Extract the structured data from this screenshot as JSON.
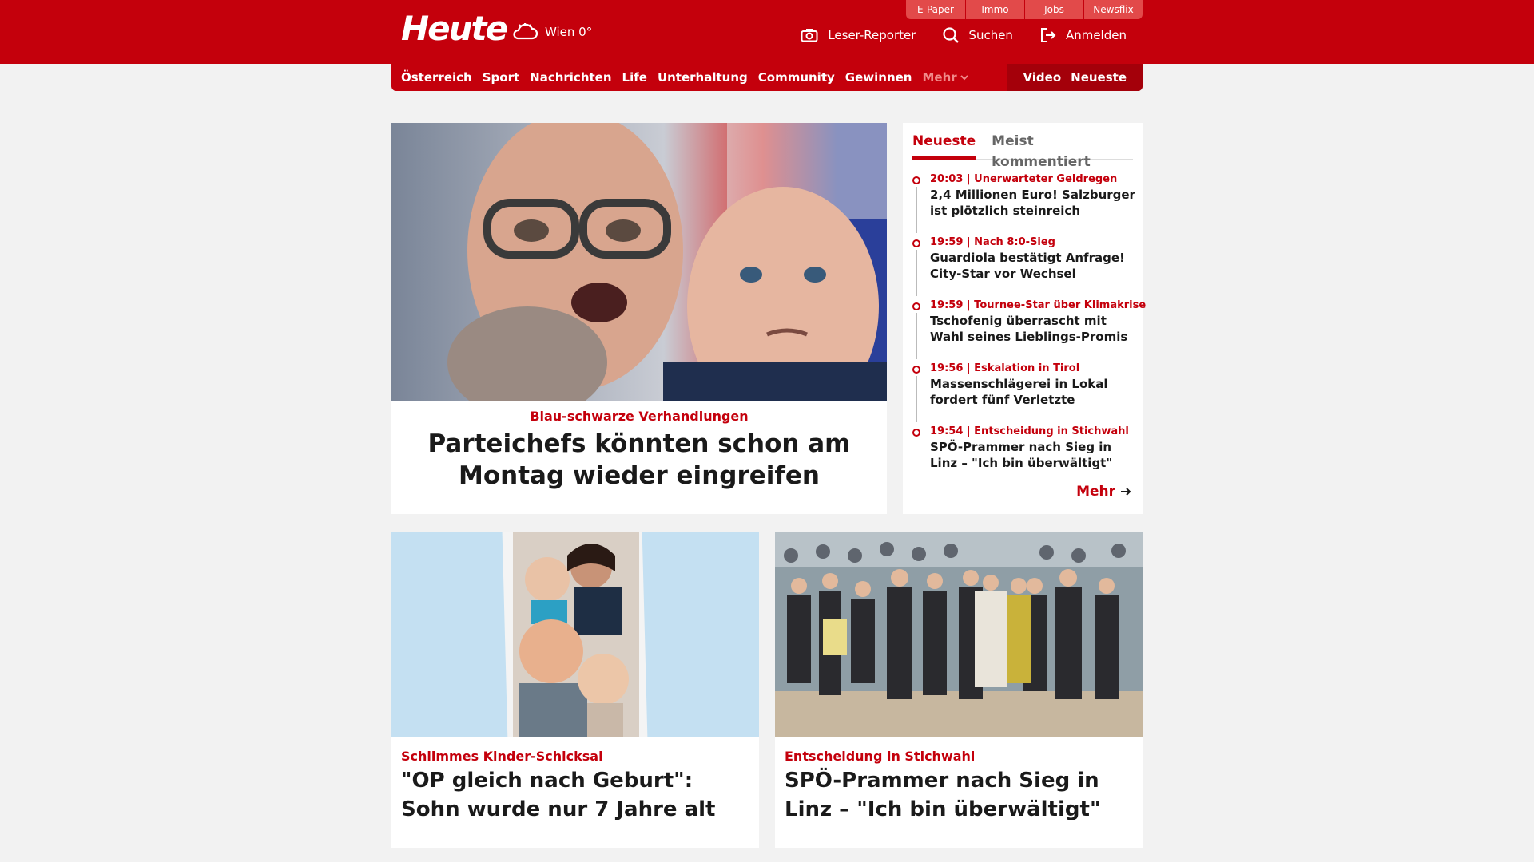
{
  "header": {
    "logo": "Heute",
    "weather": "Wien 0°",
    "quicklinks": [
      "E-Paper",
      "Immo",
      "Jobs",
      "Newsflix"
    ],
    "tools": {
      "reporter": "Leser-Reporter",
      "search": "Suchen",
      "login": "Anmelden"
    },
    "brand_color": "#c4000c"
  },
  "nav": {
    "items": [
      "Österreich",
      "Sport",
      "Nachrichten",
      "Life",
      "Unterhaltung",
      "Community",
      "Gewinnen"
    ],
    "more": "Mehr",
    "video": "Video",
    "latest": "Neueste"
  },
  "hero": {
    "kicker": "Blau-schwarze Verhandlungen",
    "title": "Parteichefs könnten schon am Montag wieder eingreifen"
  },
  "sidebar": {
    "tabs": [
      "Neueste",
      "Meist kommentiert"
    ],
    "items": [
      {
        "meta": "20:03 | Unerwarteter Geldregen",
        "title": "2,4 Millionen Euro! Salzburger ist plötzlich steinreich"
      },
      {
        "meta": "19:59 | Nach 8:0-Sieg",
        "title": "Guardiola bestätigt Anfrage! City-Star vor Wechsel"
      },
      {
        "meta": "19:59 | Tournee-Star über Klimakrise",
        "title": "Tschofenig überrascht mit Wahl seines Lieblings-Promis"
      },
      {
        "meta": "19:56 | Eskalation in Tirol",
        "title": "Massenschlägerei in Lokal fordert fünf Verletzte"
      },
      {
        "meta": "19:54 | Entscheidung in Stichwahl",
        "title": "SPÖ-Prammer nach Sieg in Linz – \"Ich bin überwältigt\""
      }
    ],
    "more": "Mehr"
  },
  "cards": [
    {
      "kicker": "Schlimmes Kinder-Schicksal",
      "title": "\"OP gleich nach Geburt\": Sohn wurde nur 7 Jahre alt"
    },
    {
      "kicker": "Entscheidung in Stichwahl",
      "title": "SPÖ-Prammer nach Sieg in Linz – \"Ich bin überwältigt\""
    }
  ]
}
